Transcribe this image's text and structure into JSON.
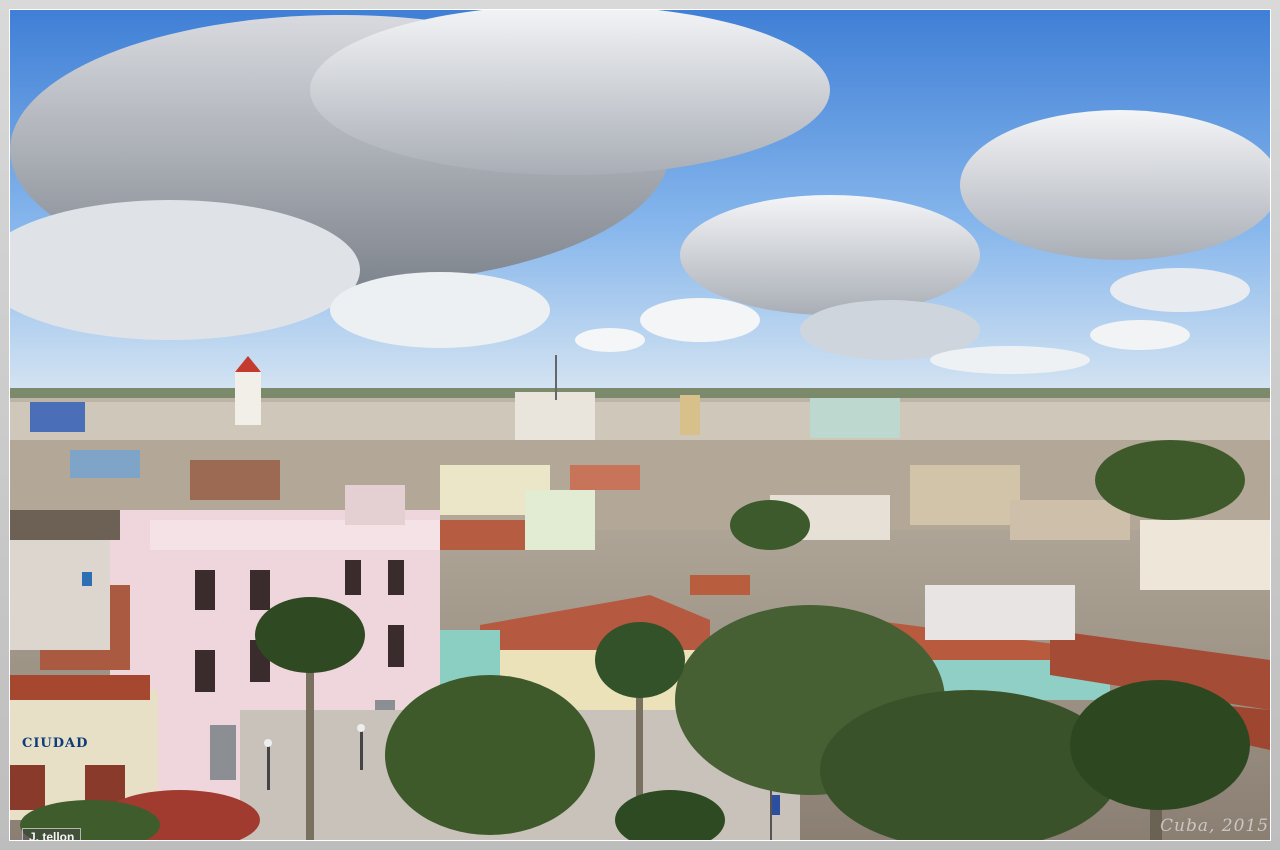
{
  "photo": {
    "sign_text": "CIUDAD",
    "watermark_left": "J. tellon",
    "watermark_right": "Cuba, 2015"
  }
}
